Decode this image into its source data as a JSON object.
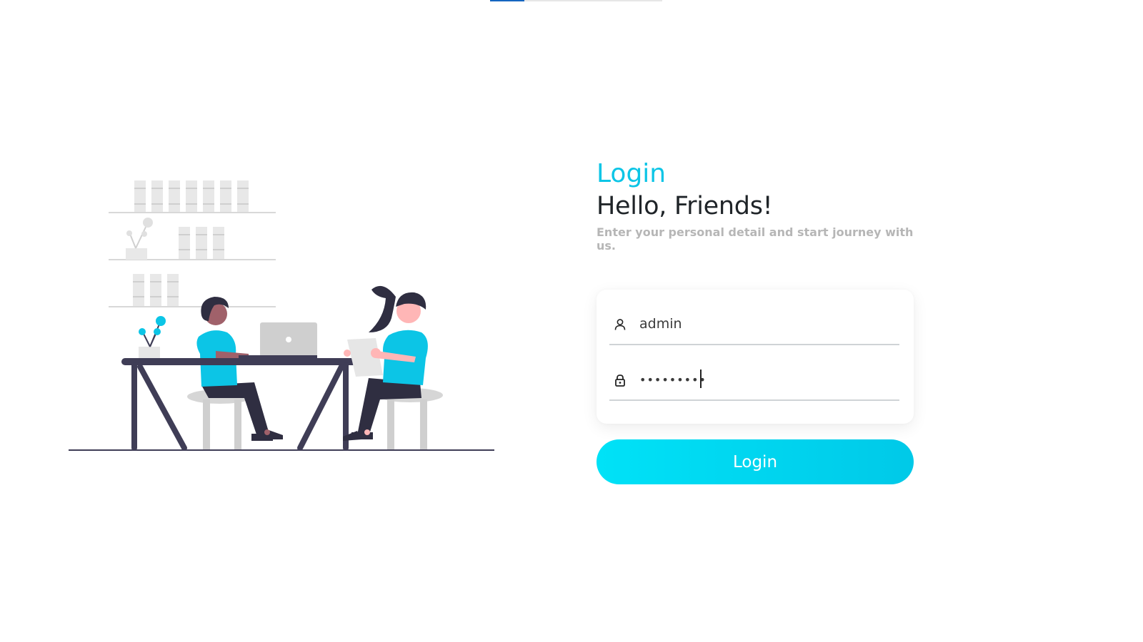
{
  "top_progress": {
    "fraction": 0.2
  },
  "login_form": {
    "heading": "Login",
    "greeting": "Hello, Friends!",
    "subtitle": "Enter your personal detail and start journey with us.",
    "username": {
      "icon": "user-icon",
      "value": "admin"
    },
    "password": {
      "icon": "lock-icon",
      "value": "•••••••••"
    },
    "submit_label": "Login"
  },
  "colors": {
    "accent": "#0cc5e6",
    "button_start": "#00e2f7",
    "button_end": "#00c9e8",
    "heading_dark": "#1f2428",
    "subtitle_gray": "#b6b6b6",
    "illustration_dark": "#3f3d56",
    "illustration_cyan": "#0cc5e6"
  }
}
